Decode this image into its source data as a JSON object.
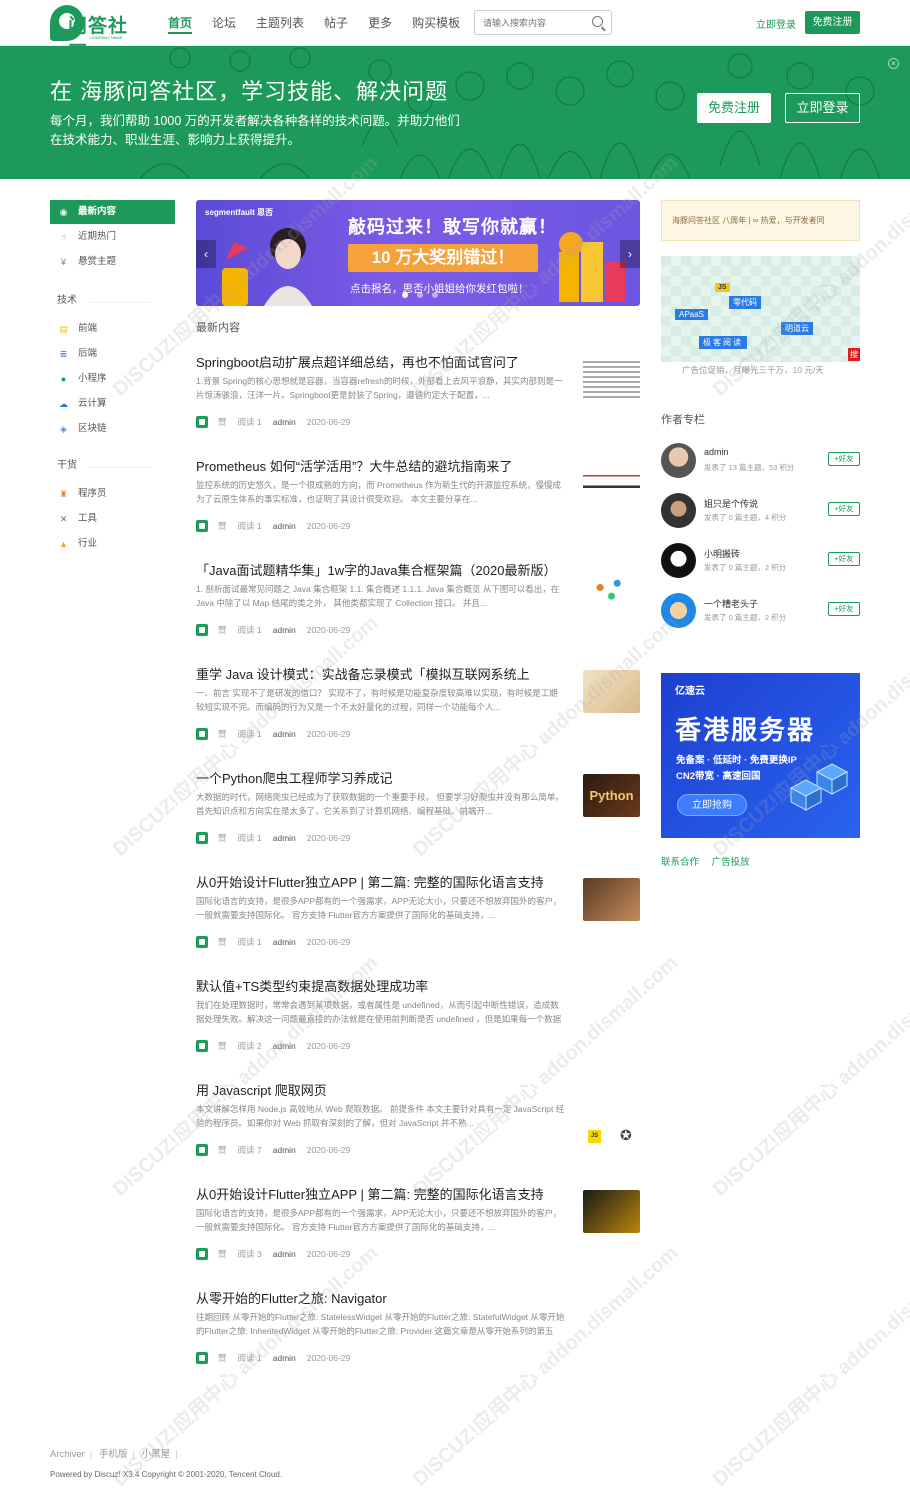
{
  "header": {
    "logo_text": "问答社区",
    "logo_sub": "COMPANY NAME",
    "nav": [
      {
        "label": "首页",
        "active": true
      },
      {
        "label": "论坛"
      },
      {
        "label": "主题列表"
      },
      {
        "label": "帖子"
      },
      {
        "label": "更多"
      },
      {
        "label": "购买模板"
      }
    ],
    "search_placeholder": "请输入搜索内容",
    "login_label": "立即登录",
    "register_label": "免费注册"
  },
  "banner": {
    "title": "在 海豚问答社区，学习技能、解决问题",
    "desc": "每个月，我们帮助 1000 万的开发者解决各种各样的技术问题。并助力他们在技术能力、职业生涯、影响力上获得提升。",
    "register_label": "免费注册",
    "login_label": "立即登录"
  },
  "sidebar": {
    "top": [
      {
        "label": "最新内容",
        "icon": "compass-icon",
        "active": true
      },
      {
        "label": "近期热门",
        "icon": "thumb-icon"
      },
      {
        "label": "悬赏主题",
        "icon": "yen-icon"
      }
    ],
    "groups": [
      {
        "title": "技术",
        "items": [
          {
            "label": "前端",
            "icon": "frontend-icon",
            "color": "#f5c518"
          },
          {
            "label": "后端",
            "icon": "database-icon",
            "color": "#2f6fd6"
          },
          {
            "label": "小程序",
            "icon": "miniapp-icon",
            "color": "#1d9a5b"
          },
          {
            "label": "云计算",
            "icon": "cloud-icon",
            "color": "#2a7be4"
          },
          {
            "label": "区块链",
            "icon": "blockchain-icon",
            "color": "#3a8ee6"
          }
        ]
      },
      {
        "title": "干货",
        "items": [
          {
            "label": "程序员",
            "icon": "programmer-icon",
            "color": "#e67e22"
          },
          {
            "label": "工具",
            "icon": "tools-icon",
            "color": "#2a7be4"
          },
          {
            "label": "行业",
            "icon": "industry-icon",
            "color": "#f5a623"
          }
        ]
      }
    ]
  },
  "carousel": {
    "brand": "segmentfault 思否",
    "line1": "敲码过来！敢写你就赢！",
    "line2": "10 万大奖别错过！",
    "line3": "点击报名，思否小姐姐给你发红包啦！"
  },
  "feed": {
    "heading": "最新内容",
    "like_label": "赞",
    "posts": [
      {
        "title": "Springboot启动扩展点超详细总结，再也不怕面试官问了",
        "summary": "1.背景 Spring的核心思想就是容器，当容器refresh的时候，外部看上去风平浪静，其实内部则是一片惊涛骇浪，汪洋一片。Springboot更是封装了Spring，遵循约定大于配置，...",
        "views": "阅读 1",
        "author": "admin",
        "date": "2020-06-29"
      },
      {
        "title": "Prometheus 如何“活学活用”？大牛总结的避坑指南来了",
        "summary": "监控系统的历史悠久，是一个很成熟的方向，而 Prometheus 作为新生代的开源监控系统，慢慢成为了云原生体系的事实标准，也证明了其设计很受欢迎。 本文主要分享在...",
        "views": "阅读 1",
        "author": "admin",
        "date": "2020-06-29"
      },
      {
        "title": "「Java面试题精华集」1w字的Java集合框架篇（2020最新版）",
        "summary": "1. 剖析面试最常见问题之 Java 集合框架 1.1. 集合概述 1.1.1. Java 集合概览 从下图可以看出，在 Java 中除了以 Map 结尾的类之外， 其他类都实现了 Collection 接口。 并且...",
        "views": "阅读 1",
        "author": "admin",
        "date": "2020-06-29"
      },
      {
        "title": "重学 Java 设计模式：实战备忘录模式「模拟互联网系统上",
        "summary": "一、前言 实现不了是研发的借口？ 实现不了，有时候是功能复杂度较高难以实现，有时候是工期较短实现不完。而编码的行为又是一个不太好量化的过程，同样一个功能每个人...",
        "views": "阅读 1",
        "author": "admin",
        "date": "2020-06-29"
      },
      {
        "title": "一个Python爬虫工程师学习养成记",
        "summary": "大数据的时代，网络爬虫已经成为了获取数据的一个重要手段。 但要学习好爬虫并没有那么简单。首先知识点和方向实在是太多了，它关系到了计算机网络、编程基础、前端开...",
        "views": "阅读 1",
        "author": "admin",
        "date": "2020-06-29"
      },
      {
        "title": "从0开始设计Flutter独立APP | 第二篇: 完整的国际化语言支持",
        "summary": "国际化语言的支持，是很多APP都有的一个强需求，APP无论大小，只要还不想放弃国外的客户，一般就需要支持国际化。 官方支持 Flutter官方方案提供了国际化的基础支持，...",
        "views": "阅读 1",
        "author": "admin",
        "date": "2020-06-29"
      },
      {
        "title": "默认值+TS类型约束提高数据处理成功率",
        "summary": "我们在处理数据时，常常会遇到某项数据，或者属性是 undefined，从而引起中断性错误，造成数据处理失败。解决这一问题最直接的办法就是在使用前判断是否 undefined ，但是如果每一个数据使用前都进行判...",
        "views": "阅读 2",
        "author": "admin",
        "date": "2020-06-29"
      },
      {
        "title": "用 Javascript 爬取网页",
        "summary": "本文讲解怎样用 Node.js 高效地从 Web 爬取数据。 前提条件 本文主要针对具有一定 JavaScript 经验的程序员。如果你对 Web 抓取有深刻的了解，但对 JavaScript 并不熟...",
        "views": "阅读 7",
        "author": "admin",
        "date": "2020-06-29"
      },
      {
        "title": "从0开始设计Flutter独立APP | 第二篇: 完整的国际化语言支持",
        "summary": "国际化语言的支持，是很多APP都有的一个强需求，APP无论大小，只要还不想放弃国外的客户，一般就需要支持国际化。 官方支持 Flutter官方方案提供了国际化的基础支持，...",
        "views": "阅读 3",
        "author": "admin",
        "date": "2020-06-29"
      },
      {
        "title": "从零开始的Flutter之旅: Navigator",
        "summary": "往期回顾 从零开始的Flutter之旅: StatelessWidget 从零开始的Flutter之旅: StatefulWidget 从零开始的Flutter之旅: InheritedWidget 从零开始的Flutter之旅: Provider 这篇文章是从零开始系列的第五期，前面...",
        "views": "阅读 1",
        "author": "admin",
        "date": "2020-06-29"
      }
    ]
  },
  "right": {
    "notice": "海豚问答社区 八周年 | ∞ 热爱，与开发者同",
    "ad1_tags": [
      "JS",
      "零代码",
      "APaaS",
      "明道云",
      "极客阅读"
    ],
    "ad1_caption": "广告位促销，月曝光三千万，10 元/天",
    "ad1_badge": "搜",
    "authors_heading": "作者专栏",
    "follow_label": "+好友",
    "authors": [
      {
        "name": "admin",
        "stats": "发表了 13 篇主题，53 积分"
      },
      {
        "name": "姐只是个传说",
        "stats": "发表了 0 篇主题，4 积分"
      },
      {
        "name": "小明搬砖",
        "stats": "发表了 0 篇主题，2 积分"
      },
      {
        "name": "一个糟老头子",
        "stats": "发表了 0 篇主题，2 积分"
      }
    ],
    "ad2": {
      "logo": "亿速云",
      "title": "香港服务器",
      "line1": "免备案 · 低延时 · 免费更换IP",
      "line2": "CN2带宽 · 高速回国",
      "button": "立即抢购"
    },
    "links": [
      "联系合作",
      "广告投放"
    ]
  },
  "footer": {
    "links": [
      "Archiver",
      "手机版",
      "小黑屋"
    ],
    "copyright": "Powered by Discuz! X3.4 Copyright © 2001-2020, Tencent Cloud."
  },
  "watermark": "DISCUZ!应用中心 addon.dismall.com"
}
